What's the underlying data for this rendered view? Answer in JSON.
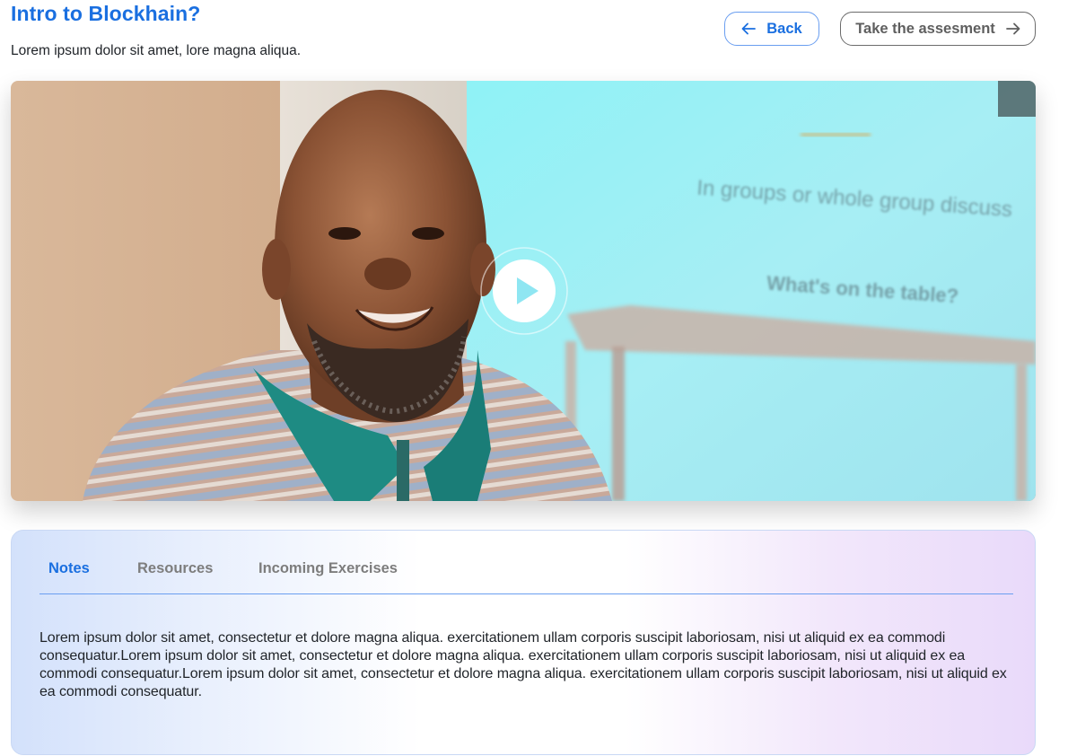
{
  "header": {
    "title": "Intro to  Blockhain?",
    "subtitle": "Lorem ipsum dolor sit amet, lore magna aliqua."
  },
  "actions": {
    "back_label": "Back",
    "back_icon": "arrow-left-icon",
    "assessment_label": "Take the assesment",
    "assessment_icon": "arrow-right-icon"
  },
  "video": {
    "slide_text_1": "In groups or whole group discuss",
    "slide_text_2": "What's on the table?",
    "play_icon": "play-icon"
  },
  "tabs": [
    {
      "label": "Notes",
      "active": true
    },
    {
      "label": "Resources",
      "active": false
    },
    {
      "label": "Incoming Exercises",
      "active": false
    }
  ],
  "notes": {
    "body": "Lorem ipsum dolor sit amet, consectetur et dolore magna aliqua. exercitationem ullam corporis suscipit laboriosam, nisi ut aliquid ex ea commodi consequatur.Lorem ipsum dolor sit amet, consectetur et dolore magna aliqua. exercitationem ullam corporis suscipit laboriosam, nisi ut aliquid ex ea commodi consequatur.Lorem ipsum dolor sit amet, consectetur et dolore magna aliqua. exercitationem ullam corporis suscipit laboriosam, nisi ut aliquid ex ea commodi consequatur."
  },
  "colors": {
    "accent": "#1a6fe0",
    "muted_tab": "#7d7d7d",
    "assessment_border": "#6b6b6b"
  }
}
